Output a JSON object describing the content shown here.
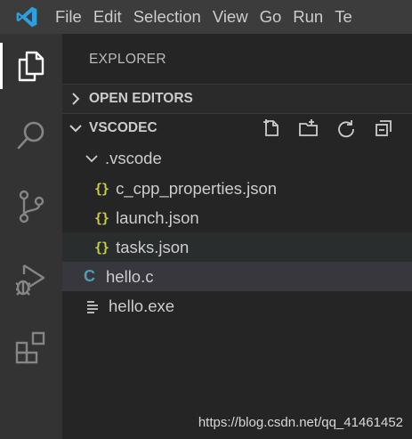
{
  "menu": [
    "File",
    "Edit",
    "Selection",
    "View",
    "Go",
    "Run",
    "Te"
  ],
  "sidebar": {
    "title": "EXPLORER",
    "open_editors_label": "OPEN EDITORS",
    "folder_label": "VSCODEC"
  },
  "tree": {
    "vscode_folder": ".vscode",
    "files": [
      "c_cpp_properties.json",
      "launch.json",
      "tasks.json"
    ],
    "json_glyph": "{}",
    "hello_c": "hello.c",
    "hello_c_glyph": "C",
    "hello_exe": "hello.exe"
  },
  "watermark": "https://blog.csdn.net/qq_41461452",
  "colors": {
    "accent": "#0078d4",
    "json_icon": "#cbcb41",
    "c_icon": "#519aba",
    "background": "#252526",
    "activity_bar": "#333333",
    "title_bar": "#3c3c3c"
  },
  "icons": {
    "activity": [
      "files-icon",
      "search-icon",
      "source-control-icon",
      "run-debug-icon",
      "extensions-icon"
    ],
    "toolbar": [
      "new-file-icon",
      "new-folder-icon",
      "refresh-icon",
      "collapse-all-icon"
    ]
  }
}
